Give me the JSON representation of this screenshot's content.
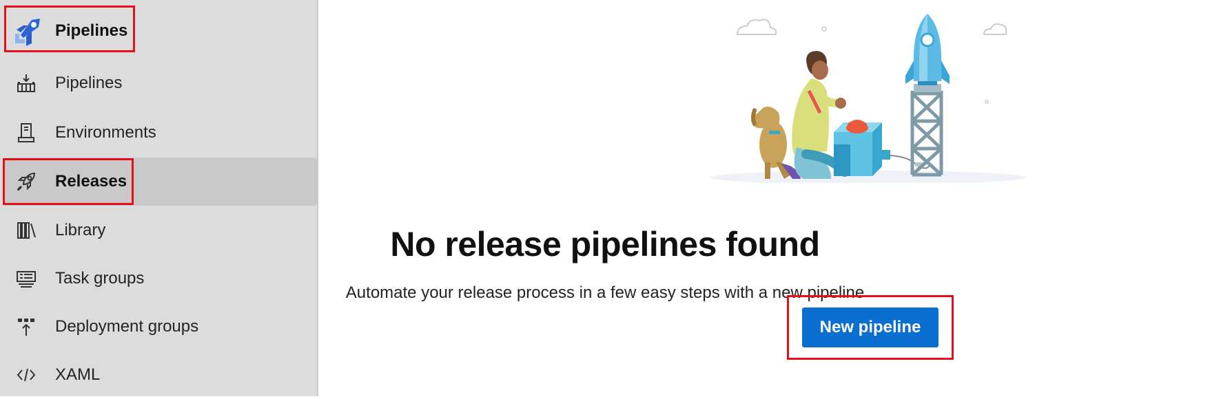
{
  "sidebar": {
    "header": {
      "label": "Pipelines",
      "icon": "pipelines-logo-icon"
    },
    "items": [
      {
        "label": "Pipelines",
        "icon": "pipeline-build-icon"
      },
      {
        "label": "Environments",
        "icon": "environment-server-icon"
      },
      {
        "label": "Releases",
        "icon": "rocket-icon",
        "selected": true
      },
      {
        "label": "Library",
        "icon": "library-books-icon"
      },
      {
        "label": "Task groups",
        "icon": "task-groups-icon"
      },
      {
        "label": "Deployment groups",
        "icon": "deployment-groups-icon"
      },
      {
        "label": "XAML",
        "icon": "code-brackets-icon"
      }
    ]
  },
  "main": {
    "title": "No release pipelines found",
    "description": "Automate your release process in a few easy steps with a new pipeline",
    "new_pipeline_label": "New pipeline"
  },
  "colors": {
    "sidebar_bg": "#dcdcdc",
    "selected_bg": "#c9c9c9",
    "primary": "#0b6fd2",
    "highlight_box": "#e3101b"
  }
}
